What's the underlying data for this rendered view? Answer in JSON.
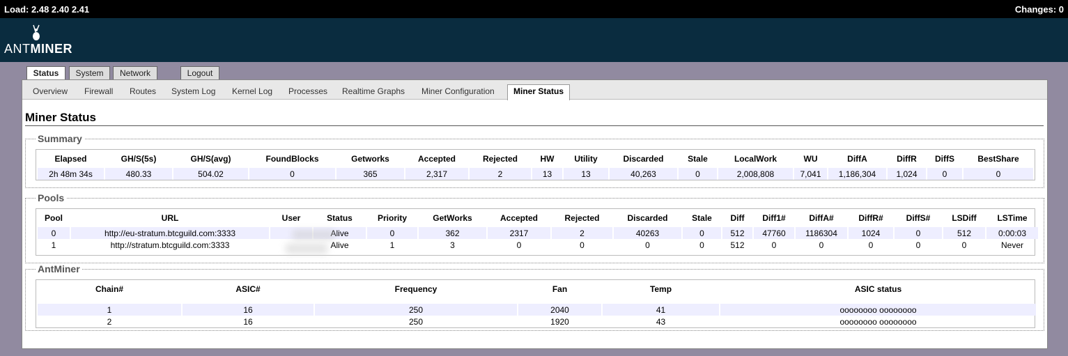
{
  "topbar": {
    "load": "Load: 2.48 2.40 2.41",
    "changes": "Changes: 0"
  },
  "brand": {
    "prefix": "ANT",
    "suffix": "MINER"
  },
  "tabs": [
    {
      "label": "Status",
      "active": true
    },
    {
      "label": "System",
      "active": false
    },
    {
      "label": "Network",
      "active": false
    },
    {
      "label": "Logout",
      "active": false
    }
  ],
  "subtabs": [
    {
      "label": "Overview"
    },
    {
      "label": "Firewall"
    },
    {
      "label": "Routes"
    },
    {
      "label": "System Log"
    },
    {
      "label": "Kernel Log"
    },
    {
      "label": "Processes"
    },
    {
      "label": "Realtime Graphs"
    },
    {
      "label": "Miner Configuration"
    },
    {
      "label": "Miner Status",
      "active": true
    }
  ],
  "page_title": "Miner Status",
  "summary": {
    "legend": "Summary",
    "headers": [
      "Elapsed",
      "GH/S(5s)",
      "GH/S(avg)",
      "FoundBlocks",
      "Getworks",
      "Accepted",
      "Rejected",
      "HW",
      "Utility",
      "Discarded",
      "Stale",
      "LocalWork",
      "WU",
      "DiffA",
      "DiffR",
      "DiffS",
      "BestShare"
    ],
    "rows": [
      [
        "2h 48m 34s",
        "480.33",
        "504.02",
        "0",
        "365",
        "2,317",
        "2",
        "13",
        "13",
        "40,263",
        "0",
        "2,008,808",
        "7,041",
        "1,186,304",
        "1,024",
        "0",
        "0"
      ]
    ]
  },
  "pools": {
    "legend": "Pools",
    "headers": [
      "Pool",
      "URL",
      "User",
      "Status",
      "Priority",
      "GetWorks",
      "Accepted",
      "Rejected",
      "Discarded",
      "Stale",
      "Diff",
      "Diff1#",
      "DiffA#",
      "DiffR#",
      "DiffS#",
      "LSDiff",
      "LSTime"
    ],
    "rows": [
      [
        "0",
        "http://eu-stratum.btcguild.com:3333",
        "",
        "Alive",
        "0",
        "362",
        "2317",
        "2",
        "40263",
        "0",
        "512",
        "47760",
        "1186304",
        "1024",
        "0",
        "512",
        "0:00:03"
      ],
      [
        "1",
        "http://stratum.btcguild.com:3333",
        "",
        "Alive",
        "1",
        "3",
        "0",
        "0",
        "0",
        "0",
        "512",
        "0",
        "0",
        "0",
        "0",
        "0",
        "Never"
      ]
    ]
  },
  "antminer": {
    "legend": "AntMiner",
    "headers": [
      "Chain#",
      "ASIC#",
      "Frequency",
      "Fan",
      "Temp",
      "ASIC status"
    ],
    "rows": [
      [
        "1",
        "16",
        "250",
        "2040",
        "41",
        "oooooooo oooooooo"
      ],
      [
        "2",
        "16",
        "250",
        "1920",
        "43",
        "oooooooo oooooooo"
      ]
    ]
  }
}
